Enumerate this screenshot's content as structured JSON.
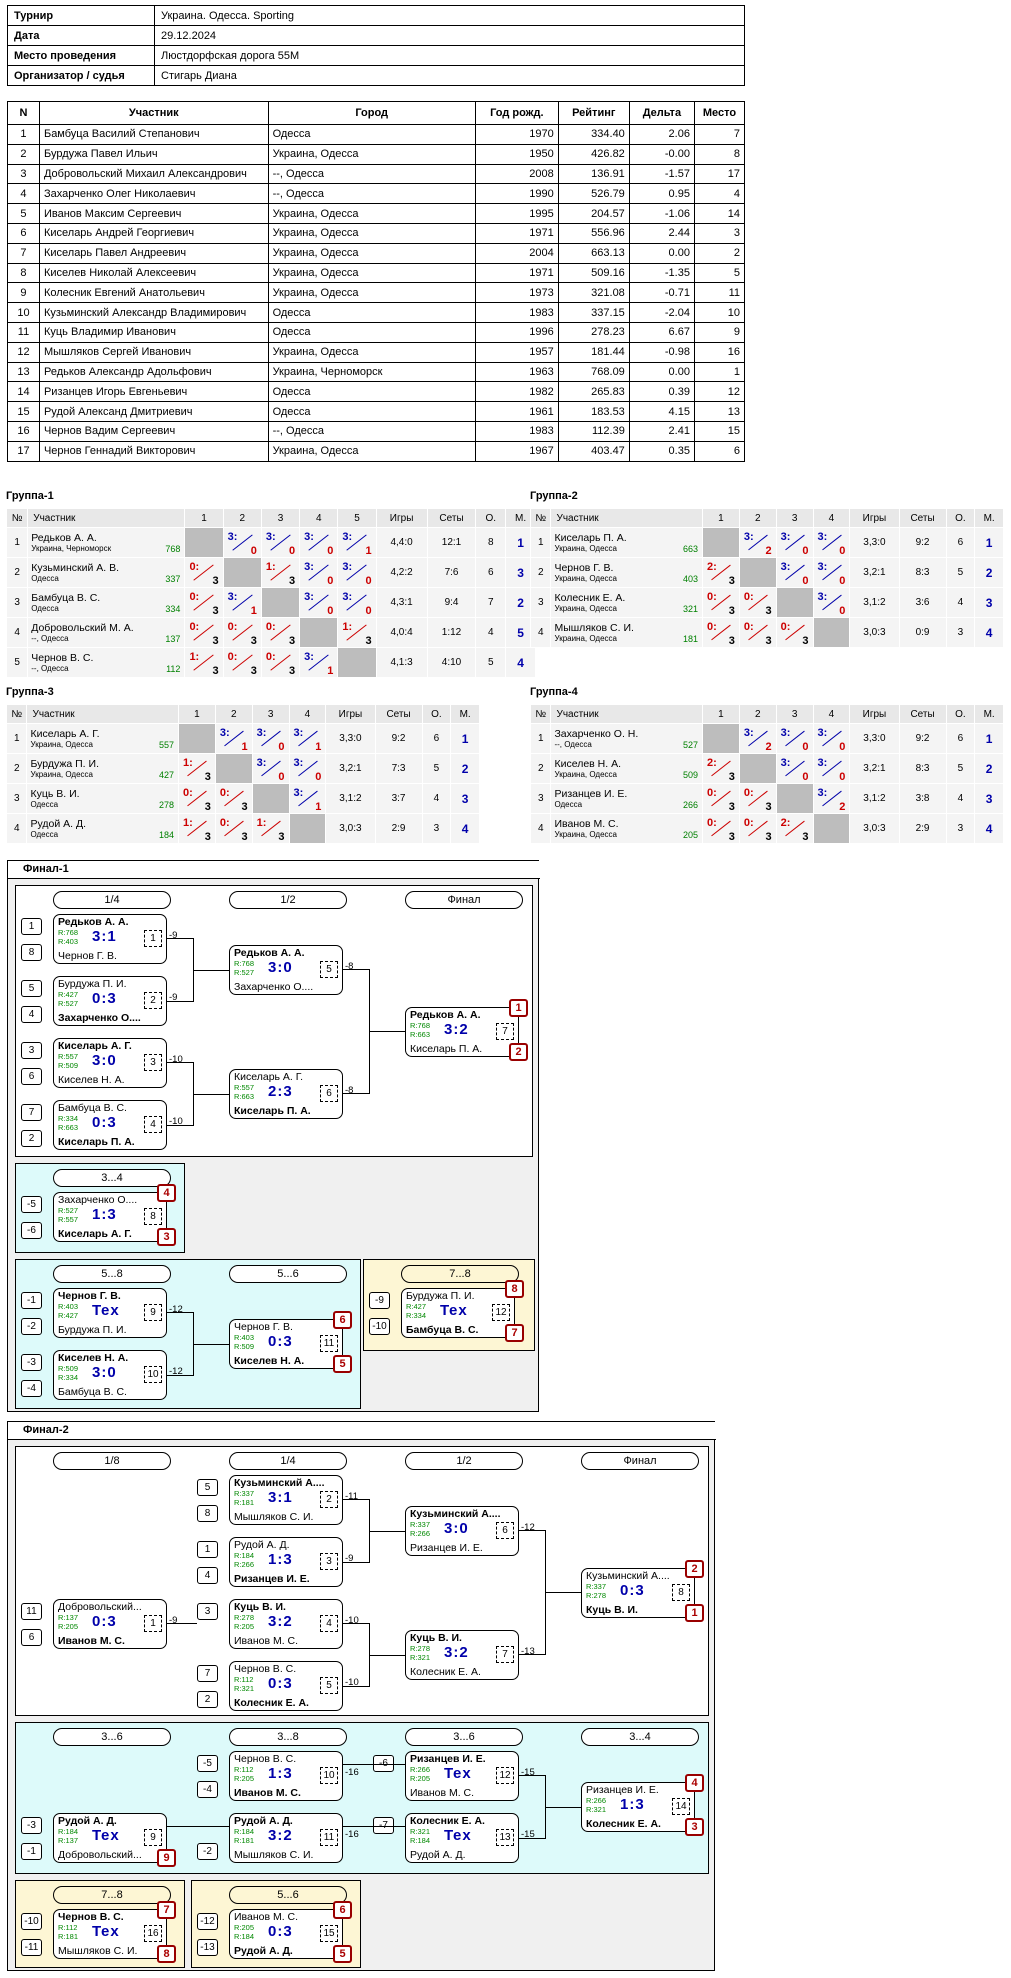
{
  "info": [
    {
      "k": "Турнир",
      "v": "Украина. Одесса. Sporting"
    },
    {
      "k": "Дата",
      "v": "29.12.2024"
    },
    {
      "k": "Место проведения",
      "v": "Люстдорфская дорога 55М"
    },
    {
      "k": "Организатор / судья",
      "v": "Стигарь Диана"
    }
  ],
  "players": {
    "headers": [
      "N",
      "Участник",
      "Город",
      "Год рожд.",
      "Рейтинг",
      "Дельта",
      "Место"
    ],
    "rows": [
      [
        "1",
        "Бамбуца Василий Степанович",
        "Одесса",
        "1970",
        "334.40",
        "2.06",
        "7"
      ],
      [
        "2",
        "Бурдужа Павел Ильич",
        "Украина, Одесса",
        "1950",
        "426.82",
        "-0.00",
        "8"
      ],
      [
        "3",
        "Добровольский Михаил Александрович",
        "--, Одесса",
        "2008",
        "136.91",
        "-1.57",
        "17"
      ],
      [
        "4",
        "Захарченко Олег Николаевич",
        "--, Одесса",
        "1990",
        "526.79",
        "0.95",
        "4"
      ],
      [
        "5",
        "Иванов Максим Сергеевич",
        "Украина, Одесса",
        "1995",
        "204.57",
        "-1.06",
        "14"
      ],
      [
        "6",
        "Киселарь Андрей Георгиевич",
        "Украина, Одесса",
        "1971",
        "556.96",
        "2.44",
        "3"
      ],
      [
        "7",
        "Киселарь Павел Андреевич",
        "Украина, Одесса",
        "2004",
        "663.13",
        "0.00",
        "2"
      ],
      [
        "8",
        "Киселев Николай Алексеевич",
        "Украина, Одесса",
        "1971",
        "509.16",
        "-1.35",
        "5"
      ],
      [
        "9",
        "Колесник Евгений Анатольевич",
        "Украина, Одесса",
        "1973",
        "321.08",
        "-0.71",
        "11"
      ],
      [
        "10",
        "Кузьминский Александр Владимирович",
        "Одесса",
        "1983",
        "337.15",
        "-2.04",
        "10"
      ],
      [
        "11",
        "Куць Владимир Иванович",
        "Одесса",
        "1996",
        "278.23",
        "6.67",
        "9"
      ],
      [
        "12",
        "Мышляков Сергей Иванович",
        "Украина, Одесса",
        "1957",
        "181.44",
        "-0.98",
        "16"
      ],
      [
        "13",
        "Редьков Александр Адольфович",
        "Украина, Черноморск",
        "1963",
        "768.09",
        "0.00",
        "1"
      ],
      [
        "14",
        "Ризанцев Игорь Евгеньевич",
        "Одесса",
        "1982",
        "265.83",
        "0.39",
        "12"
      ],
      [
        "15",
        "Рудой Александ Дмитриевич",
        "Одесса",
        "1961",
        "183.53",
        "4.15",
        "13"
      ],
      [
        "16",
        "Чернов Вадим Сергеевич",
        "--, Одесса",
        "1983",
        "112.39",
        "2.41",
        "15"
      ],
      [
        "17",
        "Чернов Геннадий Викторович",
        "Украина, Одесса",
        "1967",
        "403.47",
        "0.35",
        "6"
      ]
    ]
  },
  "group_headers": {
    "no": "№",
    "name": "Участник",
    "games": "Игры",
    "sets": "Сеты",
    "pts": "О.",
    "place": "М."
  },
  "groups": [
    {
      "title": "Группа-1",
      "rows": [
        {
          "n": "1",
          "name": "Редьков А. А.",
          "city": "Украина, Черноморск",
          "r": "768",
          "cells": [
            "X",
            "3:0|w",
            "3:0|w",
            "3:0|w",
            "3:1|w"
          ],
          "games": "4,4:0",
          "sets": "12:1",
          "pts": "8",
          "place": "1"
        },
        {
          "n": "2",
          "name": "Кузьминский А. В.",
          "city": "Одесса",
          "r": "337",
          "cells": [
            "0:3|l",
            "X",
            "1:3|l",
            "3:0|w",
            "3:0|w"
          ],
          "games": "4,2:2",
          "sets": "7:6",
          "pts": "6",
          "place": "3"
        },
        {
          "n": "3",
          "name": "Бамбуца В. С.",
          "city": "Одесса",
          "r": "334",
          "cells": [
            "0:3|l",
            "3:1|w",
            "X",
            "3:0|w",
            "3:0|w"
          ],
          "games": "4,3:1",
          "sets": "9:4",
          "pts": "7",
          "place": "2"
        },
        {
          "n": "4",
          "name": "Добровольский М. А.",
          "city": "--, Одесса",
          "r": "137",
          "cells": [
            "0:3|l",
            "0:3|l",
            "0:3|l",
            "X",
            "1:3|l"
          ],
          "games": "4,0:4",
          "sets": "1:12",
          "pts": "4",
          "place": "5"
        },
        {
          "n": "5",
          "name": "Чернов В. С.",
          "city": "--, Одесса",
          "r": "112",
          "cells": [
            "1:3|l",
            "0:3|l",
            "0:3|l",
            "3:1|w",
            "X"
          ],
          "games": "4,1:3",
          "sets": "4:10",
          "pts": "5",
          "place": "4"
        }
      ]
    },
    {
      "title": "Группа-2",
      "rows": [
        {
          "n": "1",
          "name": "Киселарь П. А.",
          "city": "Украина, Одесса",
          "r": "663",
          "cells": [
            "X",
            "3:2|w",
            "3:0|w",
            "3:0|w"
          ],
          "games": "3,3:0",
          "sets": "9:2",
          "pts": "6",
          "place": "1"
        },
        {
          "n": "2",
          "name": "Чернов Г. В.",
          "city": "Украина, Одесса",
          "r": "403",
          "cells": [
            "2:3|l",
            "X",
            "3:0|w",
            "3:0|w"
          ],
          "games": "3,2:1",
          "sets": "8:3",
          "pts": "5",
          "place": "2"
        },
        {
          "n": "3",
          "name": "Колесник Е. А.",
          "city": "Украина, Одесса",
          "r": "321",
          "cells": [
            "0:3|l",
            "0:3|l",
            "X",
            "3:0|w"
          ],
          "games": "3,1:2",
          "sets": "3:6",
          "pts": "4",
          "place": "3"
        },
        {
          "n": "4",
          "name": "Мышляков С. И.",
          "city": "Украина, Одесса",
          "r": "181",
          "cells": [
            "0:3|l",
            "0:3|l",
            "0:3|l",
            "X"
          ],
          "games": "3,0:3",
          "sets": "0:9",
          "pts": "3",
          "place": "4"
        }
      ]
    },
    {
      "title": "Группа-3",
      "rows": [
        {
          "n": "1",
          "name": "Киселарь А. Г.",
          "city": "Украина, Одесса",
          "r": "557",
          "cells": [
            "X",
            "3:1|w",
            "3:0|w",
            "3:1|w"
          ],
          "games": "3,3:0",
          "sets": "9:2",
          "pts": "6",
          "place": "1"
        },
        {
          "n": "2",
          "name": "Бурдужа П. И.",
          "city": "Украина, Одесса",
          "r": "427",
          "cells": [
            "1:3|l",
            "X",
            "3:0|w",
            "3:0|w"
          ],
          "games": "3,2:1",
          "sets": "7:3",
          "pts": "5",
          "place": "2"
        },
        {
          "n": "3",
          "name": "Куць В. И.",
          "city": "Одесса",
          "r": "278",
          "cells": [
            "0:3|l",
            "0:3|l",
            "X",
            "3:1|w"
          ],
          "games": "3,1:2",
          "sets": "3:7",
          "pts": "4",
          "place": "3"
        },
        {
          "n": "4",
          "name": "Рудой А. Д.",
          "city": "Одесса",
          "r": "184",
          "cells": [
            "1:3|l",
            "0:3|l",
            "1:3|l",
            "X"
          ],
          "games": "3,0:3",
          "sets": "2:9",
          "pts": "3",
          "place": "4"
        }
      ]
    },
    {
      "title": "Группа-4",
      "rows": [
        {
          "n": "1",
          "name": "Захарченко О. Н.",
          "city": "--, Одесса",
          "r": "527",
          "cells": [
            "X",
            "3:2|w",
            "3:0|w",
            "3:0|w"
          ],
          "games": "3,3:0",
          "sets": "9:2",
          "pts": "6",
          "place": "1"
        },
        {
          "n": "2",
          "name": "Киселев Н. А.",
          "city": "Украина, Одесса",
          "r": "509",
          "cells": [
            "2:3|l",
            "X",
            "3:0|w",
            "3:0|w"
          ],
          "games": "3,2:1",
          "sets": "8:3",
          "pts": "5",
          "place": "2"
        },
        {
          "n": "3",
          "name": "Ризанцев И. Е.",
          "city": "Одесса",
          "r": "266",
          "cells": [
            "0:3|l",
            "0:3|l",
            "X",
            "3:2|w"
          ],
          "games": "3,1:2",
          "sets": "3:8",
          "pts": "4",
          "place": "3"
        },
        {
          "n": "4",
          "name": "Иванов М. С.",
          "city": "Украина, Одесса",
          "r": "205",
          "cells": [
            "0:3|l",
            "0:3|l",
            "2:3|l",
            "X"
          ],
          "games": "3,0:3",
          "sets": "2:9",
          "pts": "3",
          "place": "4"
        }
      ]
    }
  ],
  "final1": {
    "title": "Финал-1",
    "rounds": {
      "r4": "1/4",
      "r2": "1/2",
      "f": "Финал",
      "p34": "3...4",
      "p58": "5...8",
      "p56": "5...6",
      "p78": "7...8"
    },
    "matches": {
      "m1": {
        "t": "Редьков А. А.",
        "tb": true,
        "r1": "R:768",
        "r2": "R:403",
        "s": "3:1",
        "b": "Чернов Г. В.",
        "bb": false,
        "n": "1",
        "nx": "-9"
      },
      "m2": {
        "t": "Бурдужа П. И.",
        "tb": false,
        "r1": "R:427",
        "r2": "R:527",
        "s": "0:3",
        "b": "Захарченко О....",
        "bb": true,
        "n": "2",
        "nx": "-9"
      },
      "m3": {
        "t": "Киселарь А. Г.",
        "tb": true,
        "r1": "R:557",
        "r2": "R:509",
        "s": "3:0",
        "b": "Киселев Н. А.",
        "bb": false,
        "n": "3",
        "nx": "-10"
      },
      "m4": {
        "t": "Бамбуца В. С.",
        "tb": false,
        "r1": "R:334",
        "r2": "R:663",
        "s": "0:3",
        "b": "Киселарь П. А.",
        "bb": true,
        "n": "4",
        "nx": "-10"
      },
      "m5": {
        "t": "Редьков А. А.",
        "tb": true,
        "r1": "R:768",
        "r2": "R:527",
        "s": "3:0",
        "b": "Захарченко О....",
        "bb": false,
        "n": "5",
        "nx": "-8"
      },
      "m6": {
        "t": "Киселарь А. Г.",
        "tb": false,
        "r1": "R:557",
        "r2": "R:663",
        "s": "2:3",
        "b": "Киселарь П. А.",
        "bb": true,
        "n": "6",
        "nx": "-8"
      },
      "m7": {
        "t": "Редьков А. А.",
        "tb": true,
        "r1": "R:768",
        "r2": "R:663",
        "s": "3:2",
        "b": "Киселарь П. А.",
        "bb": false,
        "n": "7",
        "p1": "1",
        "p2": "2"
      },
      "m8": {
        "t": "Захарченко О....",
        "tb": false,
        "r1": "R:527",
        "r2": "R:557",
        "s": "1:3",
        "b": "Киселарь А. Г.",
        "bb": true,
        "n": "8",
        "p1": "4",
        "p2": "3"
      },
      "m9": {
        "t": "Чернов Г. В.",
        "tb": true,
        "r1": "R:403",
        "r2": "R:427",
        "s": "Tex",
        "b": "Бурдужа П. И.",
        "bb": false,
        "n": "9",
        "nx": "-12"
      },
      "m10": {
        "t": "Киселев Н. А.",
        "tb": true,
        "r1": "R:509",
        "r2": "R:334",
        "s": "3:0",
        "b": "Бамбуца В. С.",
        "bb": false,
        "n": "10",
        "nx": "-12"
      },
      "m11": {
        "t": "Чернов Г. В.",
        "tb": false,
        "r1": "R:403",
        "r2": "R:509",
        "s": "0:3",
        "b": "Киселев Н. А.",
        "bb": true,
        "n": "11",
        "p1": "6",
        "p2": "5"
      },
      "m12": {
        "t": "Бурдужа П. И.",
        "tb": false,
        "r1": "R:427",
        "r2": "R:334",
        "s": "Tex",
        "b": "Бамбуца В. С.",
        "bb": true,
        "n": "12",
        "p1": "8",
        "p2": "7"
      }
    },
    "seeds": [
      "1",
      "8",
      "5",
      "4",
      "3",
      "6",
      "7",
      "2",
      "-5",
      "-6",
      "-1",
      "-2",
      "-3",
      "-4",
      "-9",
      "-10"
    ]
  },
  "final2": {
    "title": "Финал-2",
    "rounds": {
      "r8": "1/8",
      "r4": "1/4",
      "r2": "1/2",
      "f": "Финал",
      "p36": "3...6",
      "p38": "3...8",
      "p36b": "3...6",
      "p34": "3...4",
      "p78": "7...8",
      "p56": "5...6"
    },
    "matches": {
      "m1": {
        "t": "Добровольский...",
        "tb": false,
        "r1": "R:137",
        "r2": "R:205",
        "s": "0:3",
        "b": "Иванов М. С.",
        "bb": true,
        "n": "1",
        "nx": "-9"
      },
      "m2": {
        "t": "Кузьминский А....",
        "tb": true,
        "r1": "R:337",
        "r2": "R:181",
        "s": "3:1",
        "b": "Мышляков С. И.",
        "bb": false,
        "n": "2",
        "nx": "-11"
      },
      "m3": {
        "t": "Рудой А. Д.",
        "tb": false,
        "r1": "R:184",
        "r2": "R:266",
        "s": "1:3",
        "b": "Ризанцев И. Е.",
        "bb": true,
        "n": "3",
        "nx": "-9"
      },
      "m4": {
        "t": "Куць В. И.",
        "tb": true,
        "r1": "R:278",
        "r2": "R:205",
        "s": "3:2",
        "b": "Иванов М. С.",
        "bb": false,
        "n": "4",
        "nx": "-10"
      },
      "m5": {
        "t": "Чернов В. С.",
        "tb": false,
        "r1": "R:112",
        "r2": "R:321",
        "s": "0:3",
        "b": "Колесник Е. А.",
        "bb": true,
        "n": "5",
        "nx": "-10"
      },
      "m6": {
        "t": "Кузьминский А....",
        "tb": true,
        "r1": "R:337",
        "r2": "R:266",
        "s": "3:0",
        "b": "Ризанцев И. Е.",
        "bb": false,
        "n": "6",
        "nx": "-12"
      },
      "m7": {
        "t": "Куць В. И.",
        "tb": true,
        "r1": "R:278",
        "r2": "R:321",
        "s": "3:2",
        "b": "Колесник Е. А.",
        "bb": false,
        "n": "7",
        "nx": "-13"
      },
      "m8": {
        "t": "Кузьминский А....",
        "tb": false,
        "r1": "R:337",
        "r2": "R:278",
        "s": "0:3",
        "b": "Куць В. И.",
        "bb": true,
        "n": "8",
        "p1": "2",
        "p2": "1"
      },
      "m9": {
        "t": "Рудой А. Д.",
        "tb": true,
        "r1": "R:184",
        "r2": "R:137",
        "s": "Tex",
        "b": "Добровольский...",
        "bb": false,
        "n": "9",
        "p2": "9"
      },
      "m10": {
        "t": "Чернов В. С.",
        "tb": false,
        "r1": "R:112",
        "r2": "R:205",
        "s": "1:3",
        "b": "Иванов М. С.",
        "bb": true,
        "n": "10",
        "nx": "-16"
      },
      "m11": {
        "t": "Рудой А. Д.",
        "tb": true,
        "r1": "R:184",
        "r2": "R:181",
        "s": "3:2",
        "b": "Мышляков С. И.",
        "bb": false,
        "n": "11",
        "nx": "-16"
      },
      "m12": {
        "t": "Ризанцев И. Е.",
        "tb": true,
        "r1": "R:266",
        "r2": "R:205",
        "s": "Tex",
        "b": "Иванов М. С.",
        "bb": false,
        "n": "12",
        "nx": "-15"
      },
      "m13": {
        "t": "Колесник Е. А.",
        "tb": true,
        "r1": "R:321",
        "r2": "R:184",
        "s": "Tex",
        "b": "Рудой А. Д.",
        "bb": false,
        "n": "13",
        "nx": "-15"
      },
      "m14": {
        "t": "Ризанцев И. Е.",
        "tb": false,
        "r1": "R:266",
        "r2": "R:321",
        "s": "1:3",
        "b": "Колесник Е. А.",
        "bb": true,
        "n": "14",
        "p1": "4",
        "p2": "3"
      },
      "m16": {
        "t": "Чернов В. С.",
        "tb": true,
        "r1": "R:112",
        "r2": "R:181",
        "s": "Tex",
        "b": "Мышляков С. И.",
        "bb": false,
        "n": "16",
        "p1": "7",
        "p2": "8"
      },
      "m15": {
        "t": "Иванов М. С.",
        "tb": false,
        "r1": "R:205",
        "r2": "R:184",
        "s": "0:3",
        "b": "Рудой А. Д.",
        "bb": true,
        "n": "15",
        "p1": "6",
        "p2": "5"
      }
    },
    "seeds": [
      "8",
      "4",
      "5",
      "11",
      "6",
      "3",
      "7",
      "2",
      "-5",
      "-4",
      "-6",
      "-3",
      "-1",
      "-2",
      "-7",
      "-10",
      "-11",
      "-12",
      "-13"
    ]
  }
}
